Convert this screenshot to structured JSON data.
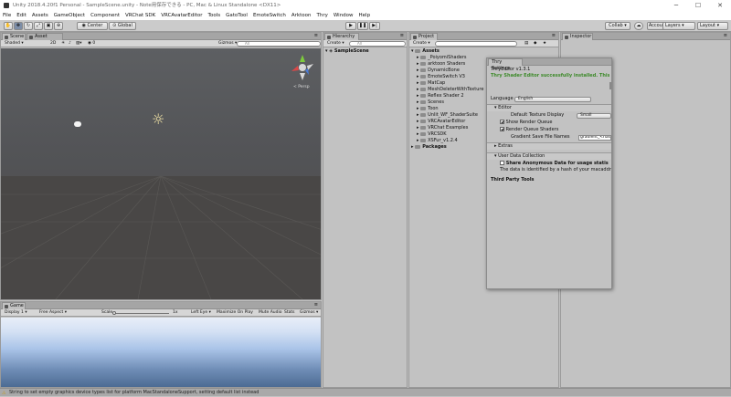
{
  "window": {
    "title": "Unity 2018.4.20f1 Personal - SampleScene.unity - Note用保存できる - PC, Mac & Linux Standalone <DX11>"
  },
  "menu": [
    "File",
    "Edit",
    "Assets",
    "GameObject",
    "Component",
    "VRChat SDK",
    "VRCAvatarEditor",
    "Tools",
    "GatoTool",
    "EmoteSwitch",
    "Arktoon",
    "Thry",
    "Window",
    "Help"
  ],
  "toolbar": {
    "pivot": "Center",
    "space": "Global",
    "collab": "Collab ▾",
    "account": "Account ▾",
    "layers": "Layers",
    "layout": "Layout"
  },
  "scene": {
    "tabs": [
      "Scene",
      "Asset Store"
    ],
    "shading": "Shaded",
    "mode_2d": "2D",
    "gizmos": "Gizmos ▾",
    "search": "All",
    "persp": "< Persp"
  },
  "game": {
    "tab": "Game",
    "display": "Display 1",
    "aspect": "Free Aspect",
    "scale_label": "Scale",
    "scale_value": "1x",
    "eye": "Left Eye",
    "maximize": "Maximize On Play",
    "mute": "Mute Audio",
    "stats": "Stats",
    "gizmos": "Gizmos ▾"
  },
  "hierarchy": {
    "tab": "Hierarchy",
    "create": "Create ▾",
    "search": "All",
    "scene": "SampleScene"
  },
  "project": {
    "tab": "Project",
    "create": "Create ▾",
    "root": "Assets",
    "folders": [
      "_PoiyomiShaders",
      "arktoon Shaders",
      "DynamicBone",
      "EmoteSwitch V3",
      "MatCap",
      "MeshDeleterWithTexture",
      "Reflex Shader 2",
      "Scenes",
      "Toon",
      "Unlit_WF_ShaderSuite",
      "VRCAvatarEditor",
      "VRChat Examples",
      "VRCSDK",
      "XSFur_v1.2.4"
    ],
    "packages": "Packages"
  },
  "inspector": {
    "tab": "Inspector"
  },
  "thry": {
    "tab": "Thry Settings",
    "version": "ThryEditor v1.3.1",
    "success": "Thry Shader Editor successfully installed. This is the edi",
    "language_label": "Language",
    "language_value": "English",
    "editor_header": "Editor",
    "texture_label": "Default Texture Display",
    "texture_value": "Small",
    "show_rq": "Show Render Queue",
    "rq_shaders": "Render Queue Shaders",
    "gradient_label": "Gradient Save File Names",
    "gradient_value": "gradient_<hash",
    "extras": "Extras",
    "udc": "User Data Collection",
    "share_title": "Share Anonymous Data for usage statis",
    "share_desc": "The data is identified by a hash of your macaddre",
    "third_party": "Third Party Tools"
  },
  "status": "String to set empty graphics device types list for platform MacStandaloneSupport, setting default list instead"
}
